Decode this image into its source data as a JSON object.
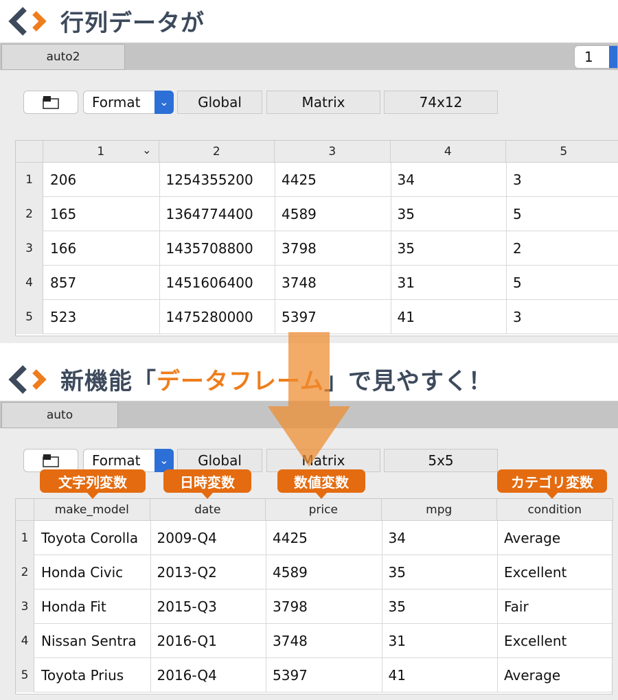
{
  "colors": {
    "accent": "#ef7d1b",
    "title": "#3d4a5c",
    "callout": "#e46b0f",
    "select_blue": "#2c6fd6"
  },
  "heading1": {
    "title": "行列データが"
  },
  "heading2": {
    "prefix": "新機能「",
    "highlight": "データフレーム",
    "suffix": "」で見やすく！"
  },
  "top": {
    "tab": "auto2",
    "spinner": "1",
    "toolbar": {
      "format": "Format",
      "scope": "Global",
      "type": "Matrix",
      "size": "74x12"
    },
    "columns": [
      "1",
      "2",
      "3",
      "4",
      "5"
    ],
    "row_labels": [
      "1",
      "2",
      "3",
      "4",
      "5"
    ],
    "rows": [
      [
        "206",
        "1254355200",
        "4425",
        "34",
        "3"
      ],
      [
        "165",
        "1364774400",
        "4589",
        "35",
        "5"
      ],
      [
        "166",
        "1435708800",
        "3798",
        "35",
        "2"
      ],
      [
        "857",
        "1451606400",
        "3748",
        "31",
        "5"
      ],
      [
        "523",
        "1475280000",
        "5397",
        "41",
        "3"
      ]
    ]
  },
  "bottom": {
    "tab": "auto",
    "toolbar": {
      "format": "Format",
      "scope": "Global",
      "type": "Matrix",
      "size": "5x5"
    },
    "callouts": [
      "文字列変数",
      "日時変数",
      "数値変数",
      "カテゴリ変数"
    ],
    "columns": [
      "make_model",
      "date",
      "price",
      "mpg",
      "condition"
    ],
    "row_labels": [
      "1",
      "2",
      "3",
      "4",
      "5"
    ],
    "rows": [
      [
        "Toyota Corolla",
        "2009-Q4",
        "4425",
        "34",
        "Average"
      ],
      [
        "Honda Civic",
        "2013-Q2",
        "4589",
        "35",
        "Excellent"
      ],
      [
        "Honda Fit",
        "2015-Q3",
        "3798",
        "35",
        "Fair"
      ],
      [
        "Nissan Sentra",
        "2016-Q1",
        "3748",
        "31",
        "Excellent"
      ],
      [
        "Toyota Prius",
        "2016-Q4",
        "5397",
        "41",
        "Average"
      ]
    ]
  }
}
